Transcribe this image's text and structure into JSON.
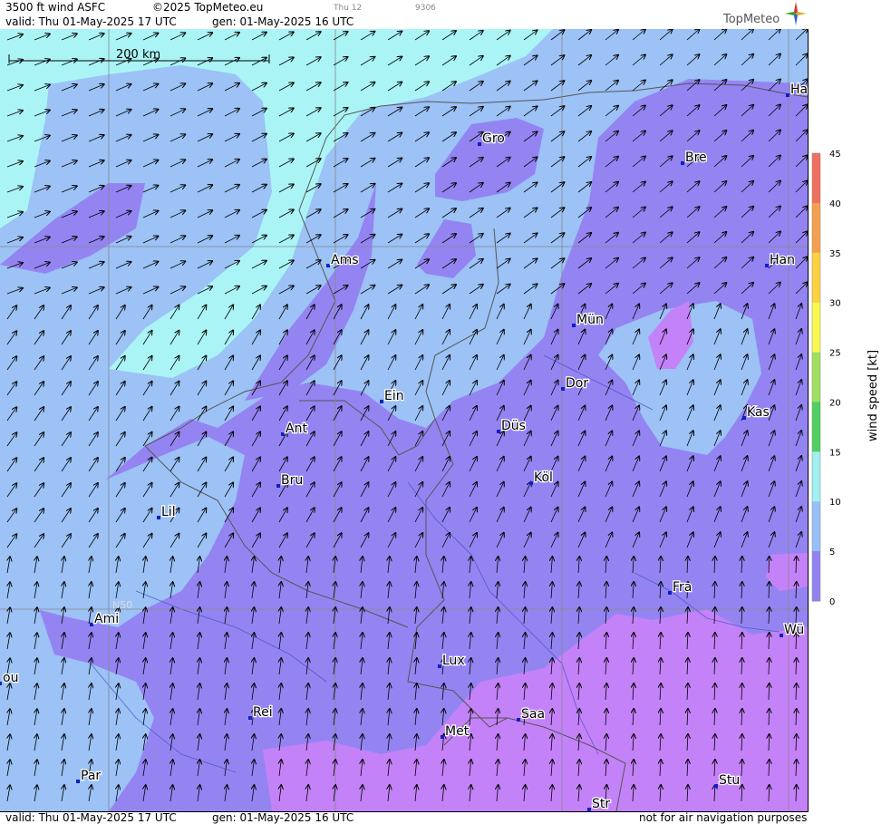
{
  "header": {
    "product": "3500 ft wind ASFC",
    "copyright": "©2025 TopMeteo.eu",
    "valid": "valid:  Thu  01-May-2025  17 UTC",
    "gen": "gen: 01-May-2025 16 UTC",
    "tiny1": "Thu 12",
    "tiny2": "9306",
    "brand": "TopMeteo"
  },
  "footer": {
    "valid": "valid:  Thu  01-May-2025  17 UTC",
    "gen": "gen: 01-May-2025 16 UTC",
    "disclaimer": "not for air navigation purposes"
  },
  "map": {
    "scale_label": "200 km",
    "lat_label": "N50",
    "cities": [
      "Ha",
      "Gro",
      "Bre",
      "Ams",
      "Han",
      "Mün",
      "Dor",
      "Ein",
      "Kas",
      "Ant",
      "Düs",
      "Bru",
      "Köl",
      "Lil",
      "Fra",
      "Ami",
      "Wü",
      "Lux",
      "ou",
      "Rei",
      "Saa",
      "Met",
      "Stu",
      "Par",
      "Str"
    ]
  },
  "legend": {
    "title": "wind speed [kt]",
    "ticks": [
      "45",
      "40",
      "35",
      "30",
      "25",
      "20",
      "15",
      "10",
      "5",
      "0"
    ],
    "colors": [
      "#f07060",
      "#f5a050",
      "#ffd040",
      "#f8f850",
      "#a0e060",
      "#50d060",
      "#a0f0f0",
      "#98c0f8",
      "#9282f0",
      "#c080f8"
    ]
  },
  "colors": {
    "cyan": "#aaf4f6",
    "lightblue": "#9cc2f6",
    "blue": "#9484f2",
    "magenta": "#c482f8"
  }
}
